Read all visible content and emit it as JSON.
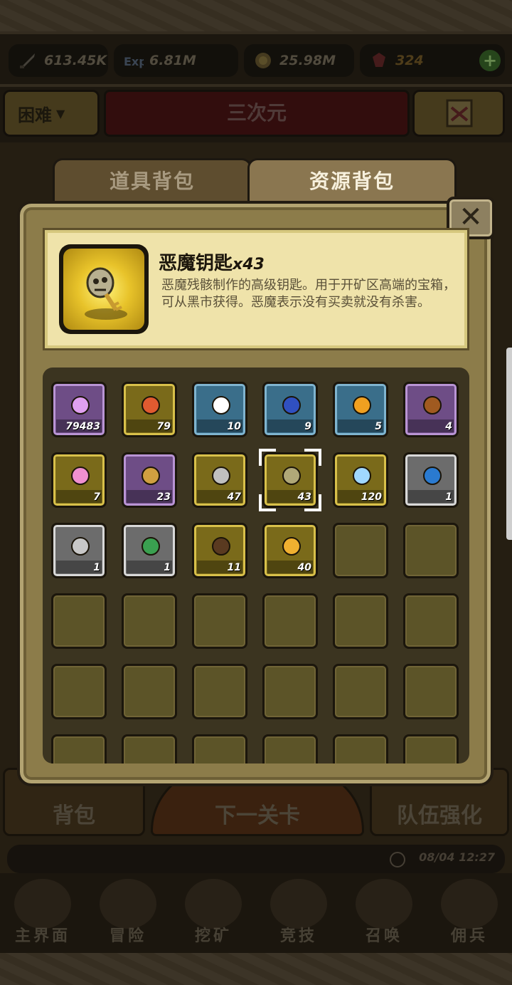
{
  "hud": {
    "attack": "613.45K",
    "exp": "6.81M",
    "gold": "25.98M",
    "gems": "324",
    "plus_icon": "plus-icon"
  },
  "stage": {
    "difficulty": "困难",
    "name": "三次元"
  },
  "tabs": [
    {
      "label": "道具背包",
      "active": false
    },
    {
      "label": "资源背包",
      "active": true
    }
  ],
  "close_label": "✕",
  "detail": {
    "name": "恶魔钥匙",
    "qty": "x43",
    "description": "恶魔残骸制作的高级钥匙。用于开矿区高端的宝箱，可从黑市获得。恶魔表示没有买卖就没有杀害。"
  },
  "inventory": [
    {
      "name": "purple-gem",
      "rarity": "epic",
      "qty": "79483",
      "color": "#e0a0f0"
    },
    {
      "name": "medal",
      "rarity": "legend",
      "qty": "79",
      "color": "#e05a30"
    },
    {
      "name": "cross",
      "rarity": "rare",
      "qty": "10",
      "color": "#ffffff"
    },
    {
      "name": "blue-skull-jar",
      "rarity": "rare",
      "qty": "9",
      "color": "#3050c0"
    },
    {
      "name": "gold-egg",
      "rarity": "rare",
      "qty": "5",
      "color": "#f0a020"
    },
    {
      "name": "brown-book",
      "rarity": "epic",
      "qty": "4",
      "color": "#a05a20"
    },
    {
      "name": "potion",
      "rarity": "legend",
      "qty": "7",
      "color": "#f090d0"
    },
    {
      "name": "gold-key",
      "rarity": "epic",
      "qty": "23",
      "color": "#d0a040"
    },
    {
      "name": "silver-key",
      "rarity": "legend",
      "qty": "47",
      "color": "#c0c0c0"
    },
    {
      "name": "demon-key",
      "rarity": "legend",
      "qty": "43",
      "color": "#b0a878",
      "selected": true
    },
    {
      "name": "crystal-orb",
      "rarity": "legend",
      "qty": "120",
      "color": "#a0d8ff"
    },
    {
      "name": "blue-stone",
      "rarity": "common",
      "qty": "1",
      "color": "#2a7ad0"
    },
    {
      "name": "silver-ore",
      "rarity": "common",
      "qty": "1",
      "color": "#c8c8c8"
    },
    {
      "name": "green-ore",
      "rarity": "common",
      "qty": "1",
      "color": "#3aa050"
    },
    {
      "name": "bat-wings",
      "rarity": "legend",
      "qty": "11",
      "color": "#5a3a20"
    },
    {
      "name": "gold-crystal",
      "rarity": "legend",
      "qty": "40",
      "color": "#f0b030"
    }
  ],
  "under": {
    "bag": "背包",
    "next_stage": "下一关卡",
    "team_upgrade": "队伍强化",
    "clock": "08/04 12:27"
  },
  "nav": [
    {
      "label": "主界面"
    },
    {
      "label": "冒险"
    },
    {
      "label": "挖矿"
    },
    {
      "label": "竞技"
    },
    {
      "label": "召唤"
    },
    {
      "label": "佣兵"
    }
  ]
}
